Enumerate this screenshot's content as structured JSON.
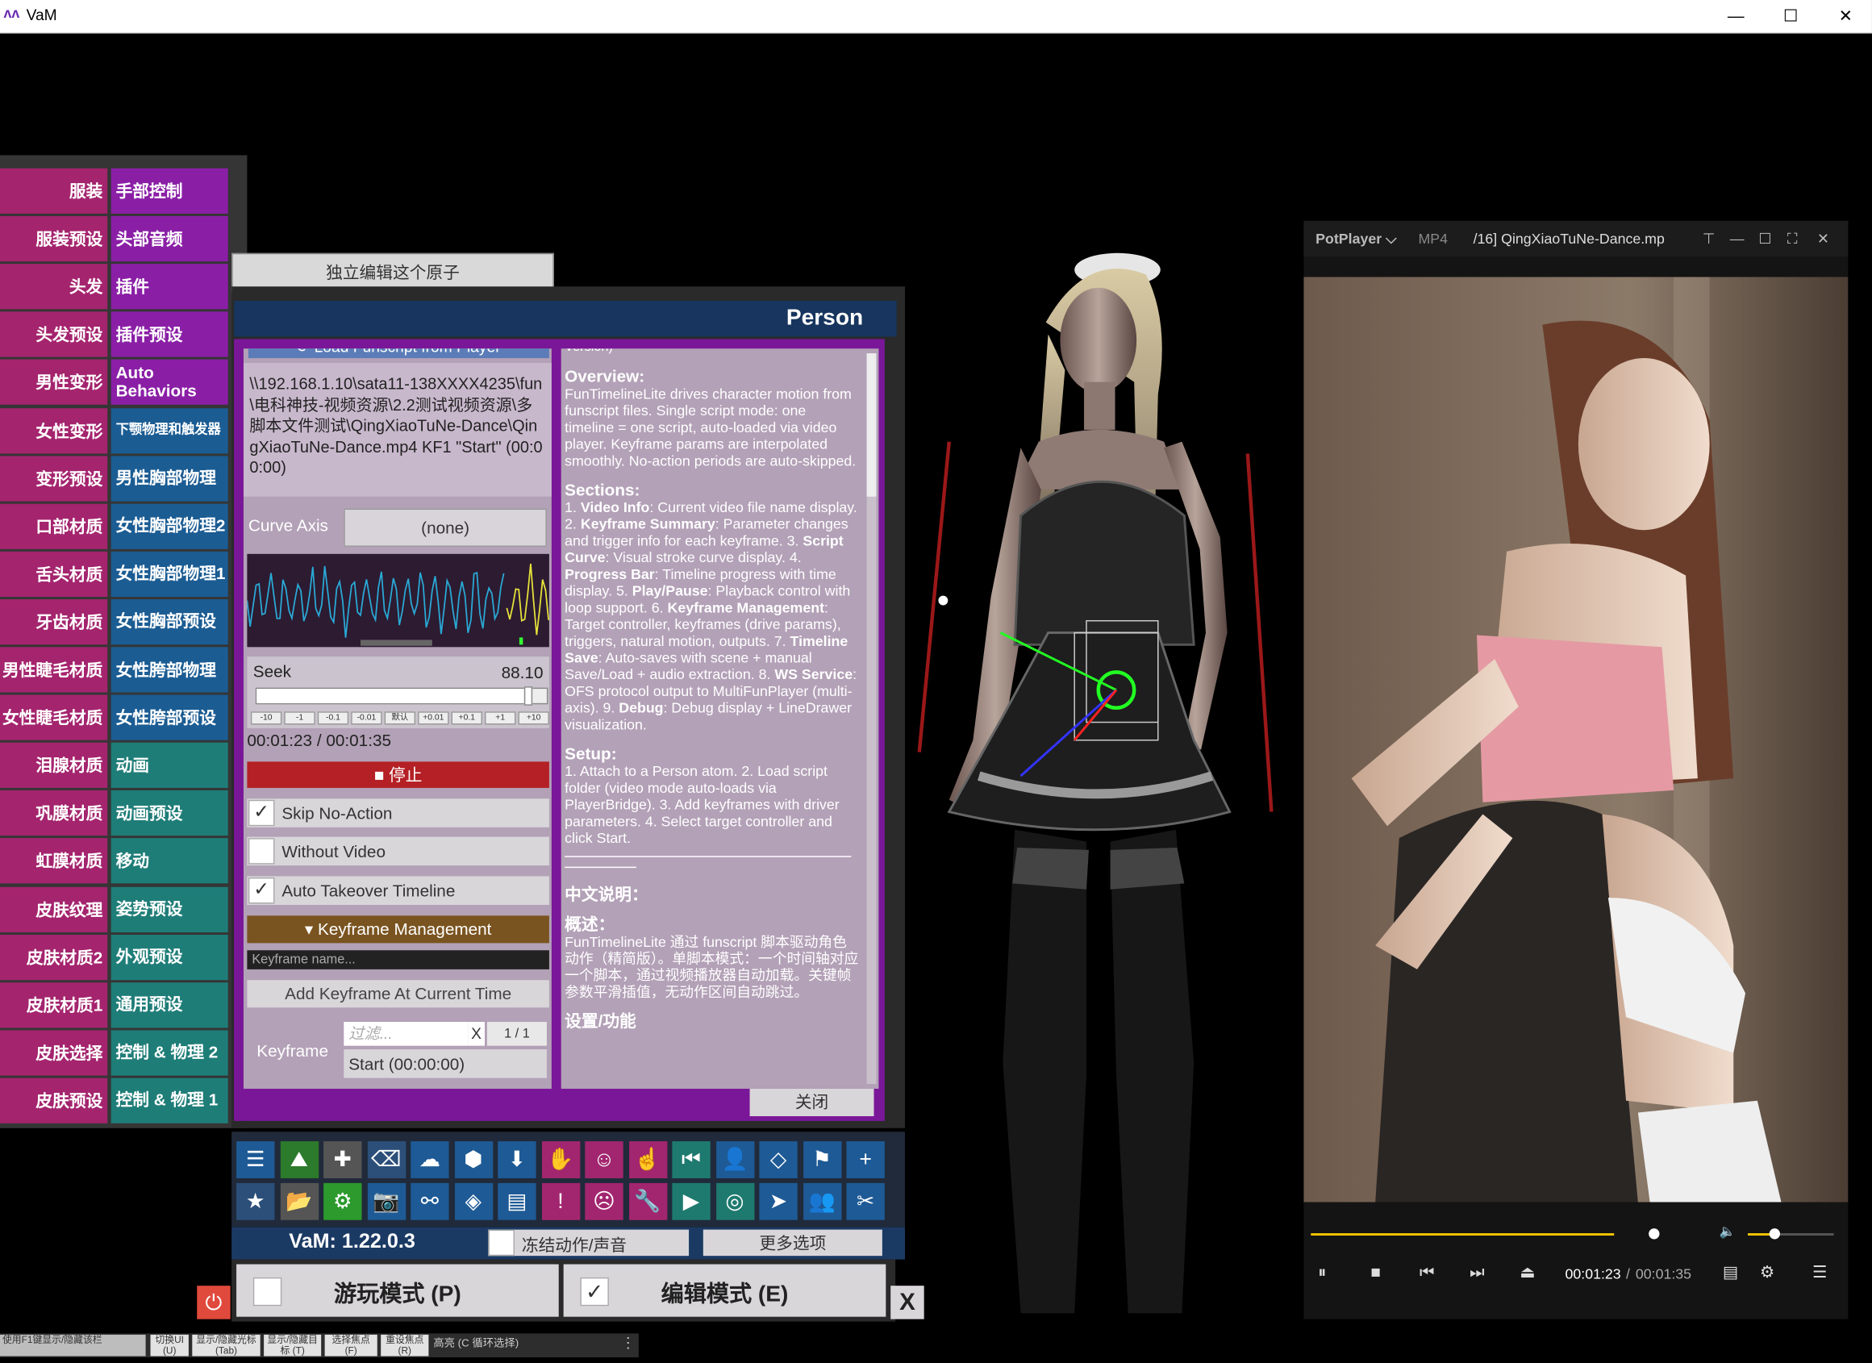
{
  "window": {
    "title": "VaM",
    "minimize": "—",
    "maximize": "☐",
    "close": "✕"
  },
  "left_menu": [
    {
      "a": "服装",
      "b": "手部控制",
      "b_color": "pur"
    },
    {
      "a": "服装预设",
      "b": "头部音频",
      "b_color": "pur"
    },
    {
      "a": "头发",
      "b": "插件",
      "b_color": "pur"
    },
    {
      "a": "头发预设",
      "b": "插件预设",
      "b_color": "pur"
    },
    {
      "a": "男性变形",
      "b": "Auto Behaviors",
      "b_color": "pur"
    },
    {
      "a": "女性变形",
      "b": "下颚物理和触发器",
      "b_color": "blu",
      "small": true
    },
    {
      "a": "变形预设",
      "b": "男性胸部物理",
      "b_color": "blu"
    },
    {
      "a": "口部材质",
      "b": "女性胸部物理2",
      "b_color": "blu"
    },
    {
      "a": "舌头材质",
      "b": "女性胸部物理1",
      "b_color": "blu"
    },
    {
      "a": "牙齿材质",
      "b": "女性胸部预设",
      "b_color": "blu"
    },
    {
      "a": "男性睫毛材质",
      "b": "女性胯部物理",
      "b_color": "blu"
    },
    {
      "a": "女性睫毛材质",
      "b": "女性胯部预设",
      "b_color": "blu"
    },
    {
      "a": "泪腺材质",
      "b": "动画",
      "b_color": "tea"
    },
    {
      "a": "巩膜材质",
      "b": "动画预设",
      "b_color": "tea"
    },
    {
      "a": "虹膜材质",
      "b": "移动",
      "b_color": "tea"
    },
    {
      "a": "皮肤纹理",
      "b": "姿势预设",
      "b_color": "tea"
    },
    {
      "a": "皮肤材质2",
      "b": "外观预设",
      "b_color": "tea"
    },
    {
      "a": "皮肤材质1",
      "b": "通用预设",
      "b_color": "tea"
    },
    {
      "a": "皮肤选择",
      "b": "控制 & 物理 2",
      "b_color": "tea"
    },
    {
      "a": "皮肤预设",
      "b": "控制 & 物理 1",
      "b_color": "tea"
    }
  ],
  "solo_button": "独立编辑这个原子",
  "person_panel": {
    "title": "Person",
    "load_button": "⟳ Load Funscript from Player",
    "path_text": "\\\\192.168.1.10\\sata11-138XXXX4235\\fun\\电科神技-视频资源\\2.2测试视频资源\\多脚本文件测试\\QingXiaoTuNe-Dance\\QingXiaoTuNe-Dance.mp4 KF1 \"Start\" (00:00:00)",
    "curve_axis_label": "Curve Axis",
    "curve_axis_value": "(none)",
    "seek_label": "Seek",
    "seek_value": "88.10",
    "seek_fraction": 0.94,
    "seek_steps": [
      "-10",
      "-1",
      "-0.1",
      "-0.01",
      "默认",
      "+0.01",
      "+0.1",
      "+1",
      "+10"
    ],
    "time": "00:01:23 / 00:01:35",
    "stop_button": "■ 停止",
    "checks": [
      {
        "label": "Skip No-Action",
        "checked": "✓"
      },
      {
        "label": "Without Video",
        "checked": ""
      },
      {
        "label": "Auto Takeover Timeline",
        "checked": "✓"
      }
    ],
    "keyframe_mgmt": "▾ Keyframe Management",
    "keyframe_name_placeholder": "Keyframe name...",
    "add_keyframe": "Add Keyframe At Current Time",
    "keyframe_label": "Keyframe",
    "filter_placeholder": "过滤...",
    "filter_clear": "X",
    "filter_count": "1 / 1",
    "keyframe_selected": "Start (00:00:00)",
    "close_button": "关闭",
    "help": {
      "version_stub": "Version)",
      "overview_h": "Overview:",
      "overview": "FunTimelineLite drives character motion from funscript files. Single script mode: one timeline = one script, auto-loaded via video player. Keyframe params are interpolated smoothly. No-action periods are auto-skipped.",
      "sections_h": "Sections:",
      "s1_pre": "1. ",
      "s1_b": "Video Info",
      "s1": ": Current video file name display. 2. ",
      "s2_b": "Keyframe Summary",
      "s2": ": Parameter changes and trigger info for each keyframe. 3. ",
      "s3_b": "Script Curve",
      "s3": ": Visual stroke curve display. 4. ",
      "s4_b": "Progress Bar",
      "s4": ": Timeline progress with time display. 5. ",
      "s5_b": "Play/Pause",
      "s5": ": Playback control with loop support. 6. ",
      "s6_b": "Keyframe Management",
      "s6": ": Target controller, keyframes (drive params), triggers, natural motion, outputs. 7. ",
      "s7_b": "Timeline Save",
      "s7": ": Auto-saves with scene + manual Save/Load + audio extraction. 8. ",
      "s8_b": "WS Service",
      "s8": ": OFS protocol output to MultiFunPlayer (multi-axis). 9. ",
      "s9_b": "Debug",
      "s9": ": Debug display + LineDrawer visualization.",
      "setup_h": "Setup:",
      "setup": "1. Attach to a Person atom. 2. Load script folder (video mode auto-loads via PlayerBridge). 3. Add keyframes with driver parameters. 4. Select target controller and click Start.",
      "cn_h": "中文说明：",
      "cn_overview_h": "概述：",
      "cn_overview": "FunTimelineLite 通过 funscript 脚本驱动角色动作（精简版）。单脚本模式：一个时间轴对应一个脚本，通过视频播放器自动加载。关键帧参数平滑插值，无动作区间自动跳过。",
      "cn_next_h": "设置/功能"
    }
  },
  "toolbar_icons": [
    "menu-icon",
    "scene-icon",
    "plugin-icon",
    "clear-icon",
    "cloud-icon",
    "cube-icon",
    "inbox-icon",
    "hand-icon",
    "person-add-icon",
    "finger-icon",
    "skip-back-icon",
    "person-icon",
    "unity-icon",
    "flag-icon",
    "plus-icon",
    "star-icon",
    "folder-icon",
    "gear-green-icon",
    "camera-icon",
    "nodes-icon",
    "layers-icon",
    "document-icon",
    "alert-icon",
    "person-remove-icon",
    "wrench-icon",
    "play-icon",
    "target-icon",
    "pointer-icon",
    "people-icon",
    "tools-icon"
  ],
  "bottom": {
    "version": "VaM: 1.22.0.3",
    "freeze": "冻结动作/声音",
    "more_options": "更多选项",
    "play_mode": "游玩模式 (P)",
    "edit_mode": "编辑模式 (E)",
    "edit_checked": "✓",
    "x_button": "X",
    "power": "⏻"
  },
  "statusbar": {
    "hint": "使用F1键显示/隐藏该栏",
    "items": [
      "切换UI (U)",
      "显示/隐藏光标 (Tab)",
      "显示/隐藏目标 (T)",
      "选择焦点 (F)",
      "重设焦点 (R)"
    ],
    "highlight": "高亮 (C 循环选择)",
    "more": "⋮"
  },
  "potplayer": {
    "app": "PotPlayer ⌵",
    "format": "MP4",
    "file": "/16] QingXiaoTuNe-Dance.mp",
    "pin": "⊤",
    "min": "—",
    "max": "☐",
    "full": "⛶",
    "close": "✕",
    "seek_fraction": 0.87,
    "volume_fraction": 0.3,
    "time_current": "00:01:23",
    "time_sep": "/",
    "time_total": "00:01:35",
    "pause": "⏸",
    "stop": "■",
    "prev": "⏮",
    "next": "⏭",
    "eject": "⏏",
    "playlist": "▤",
    "settings": "⚙",
    "menu": "☰",
    "volume": "🔈"
  }
}
